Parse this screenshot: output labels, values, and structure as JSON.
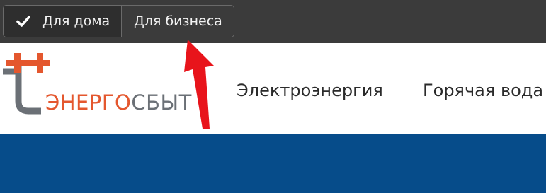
{
  "topbar": {
    "segments": [
      {
        "label": "Для дома",
        "icon": "check-icon",
        "selected": true
      },
      {
        "label": "Для бизнеса",
        "selected": false
      }
    ]
  },
  "header": {
    "logo": {
      "text_part_a": "ЭНЕРГО",
      "text_part_b": "СБЫТ",
      "brand_orange": "#E4572E",
      "brand_gray": "#6B7076"
    },
    "nav": [
      {
        "label": "Электроэнергия"
      },
      {
        "label": "Горячая вода"
      }
    ]
  },
  "colors": {
    "topbar_bg": "#3B3B3B",
    "selected_segment_bg": "#2E2E2E",
    "blue_band": "#064C8A",
    "annotation_arrow": "#E8141B"
  }
}
